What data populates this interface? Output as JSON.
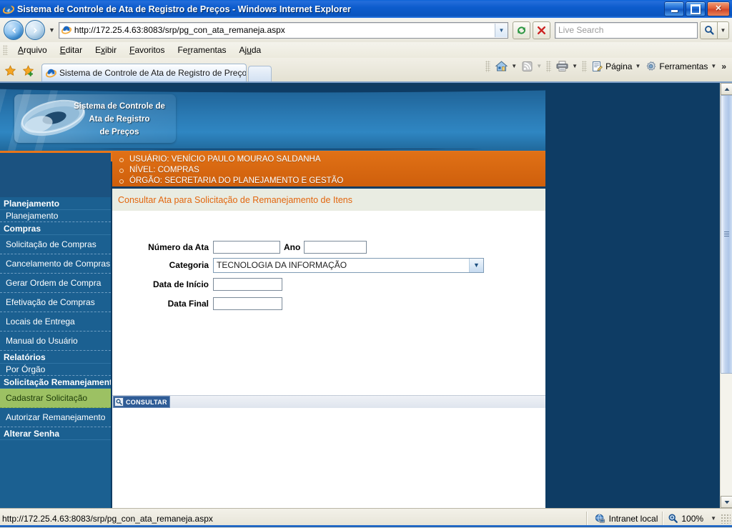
{
  "window": {
    "title": "Sistema de Controle de Ata de Registro de Preços - Windows Internet Explorer",
    "minimize_label": "Minimizar",
    "maximize_label": "Restaurar",
    "close_label": "Fechar"
  },
  "address_bar": {
    "back_glyph": "◀",
    "forward_glyph": "▶",
    "history_caret": "▼",
    "url": "http://172.25.4.63:8083/srp/pg_con_ata_remaneja.aspx",
    "url_dropdown_glyph": "▼",
    "refresh_label": "Atualizar",
    "stop_label": "Parar",
    "search_placeholder": "Live Search",
    "search_value": "",
    "search_dropdown_glyph": "▼"
  },
  "menubar": {
    "items": [
      {
        "label": "Arquivo",
        "accel": "A"
      },
      {
        "label": "Editar",
        "accel": "E"
      },
      {
        "label": "Exibir",
        "accel": "x"
      },
      {
        "label": "Favoritos",
        "accel": "F"
      },
      {
        "label": "Ferramentas",
        "accel": "r"
      },
      {
        "label": "Ajuda",
        "accel": "u"
      }
    ]
  },
  "tabbar": {
    "favorites_star_label": "Favoritos",
    "add_favorite_label": "Adicionar a Favoritos",
    "tabs": [
      {
        "title": "Sistema de Controle de Ata de Registro de Preços",
        "active": true
      }
    ],
    "new_tab_label": "Nova Guia",
    "tools": [
      {
        "name": "home",
        "label": "",
        "caret": "▼"
      },
      {
        "name": "feeds",
        "label": "",
        "caret": "▼"
      },
      {
        "name": "print",
        "label": "",
        "caret": "▼"
      },
      {
        "name": "page",
        "label": "Página",
        "caret": "▼"
      },
      {
        "name": "tools",
        "label": "Ferramentas",
        "caret": "▼"
      }
    ],
    "overflow_glyph": "»"
  },
  "page": {
    "logo": {
      "line1": "Sistema de Controle de",
      "line2": "Ata de Registro",
      "line3": "de Preços"
    },
    "info": [
      "USUÁRIO: VENÍCIO PAULO MOURAO SALDANHA",
      "NÍVEL: COMPRAS",
      "ÓRGÃO: SECRETARIA DO PLANEJAMENTO E GESTÃO"
    ],
    "page_title": "Consultar Ata para Solicitação de Remanejamento de Itens",
    "sidebar": [
      {
        "label": "Planejamento",
        "type": "group"
      },
      {
        "label": "Planejamento",
        "type": "sub"
      },
      {
        "label": "Compras",
        "type": "group"
      },
      {
        "label": "Solicitação de Compras",
        "type": "tall"
      },
      {
        "label": "Cancelamento de Compras",
        "type": "tall"
      },
      {
        "label": "Gerar Ordem de Compra",
        "type": "tall"
      },
      {
        "label": "Efetivação de Compras",
        "type": "tall"
      },
      {
        "label": "Locais de Entrega",
        "type": "tall"
      },
      {
        "label": "Manual do Usuário",
        "type": "tall"
      },
      {
        "label": "Relatórios",
        "type": "group"
      },
      {
        "label": "Por Órgão",
        "type": "sub"
      },
      {
        "label": "Solicitação Remanejamento",
        "type": "group"
      },
      {
        "label": "Cadastrar Solicitação",
        "type": "tall",
        "active": true
      },
      {
        "label": "Autorizar Remanejamento",
        "type": "tall"
      },
      {
        "label": "Alterar Senha",
        "type": "group"
      }
    ],
    "form": {
      "numero_ata_label": "Número da Ata",
      "numero_ata_value": "",
      "ano_label": "Ano",
      "ano_value": "",
      "categoria_label": "Categoria",
      "categoria_value": "TECNOLOGIA DA INFORMAÇÃO",
      "categoria_arrow": "▼",
      "data_inicio_label": "Data de Início",
      "data_inicio_value": "",
      "data_final_label": "Data Final",
      "data_final_value": "",
      "consultar_label": "CONSULTAR"
    }
  },
  "scrollbar": {
    "up_glyph": "▲",
    "down_glyph": "▼"
  },
  "statusbar": {
    "url": "http://172.25.4.63:8083/srp/pg_con_ata_remaneja.aspx",
    "zone": "Intranet local",
    "zoom": "100%",
    "zoom_caret": "▼"
  },
  "colors": {
    "accent_orange": "#e2660e",
    "banner_blue": "#2a7ab4",
    "sidebar_blue": "#1b6091",
    "active_green": "#9cc163",
    "title_blue": "#0d5ccd"
  }
}
